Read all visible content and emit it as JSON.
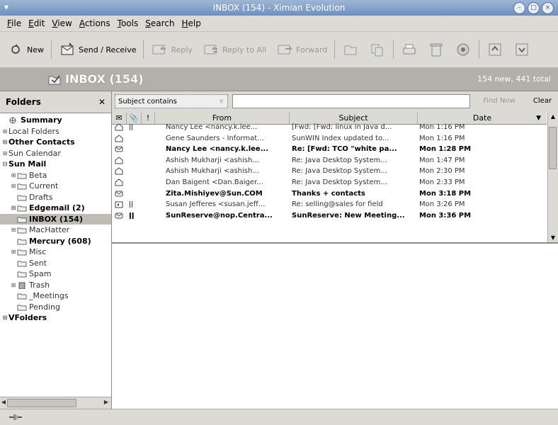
{
  "window": {
    "title": "INBOX (154) - Ximian Evolution"
  },
  "menu": [
    {
      "key": "file",
      "accel": "F",
      "rest": "ile"
    },
    {
      "key": "edit",
      "accel": "E",
      "rest": "dit"
    },
    {
      "key": "view",
      "accel": "V",
      "rest": "iew"
    },
    {
      "key": "actions",
      "accel": "A",
      "rest": "ctions"
    },
    {
      "key": "tools",
      "accel": "T",
      "rest": "ools"
    },
    {
      "key": "search",
      "accel": "S",
      "rest": "earch"
    },
    {
      "key": "help",
      "accel": "H",
      "rest": "elp"
    }
  ],
  "toolbar": {
    "new_label": "New",
    "send_receive_label": "Send / Receive",
    "reply_label": "Reply",
    "reply_all_label": "Reply to All",
    "forward_label": "Forward"
  },
  "folder_header": {
    "name": "INBOX (154)",
    "counts": "154 new, 441 total"
  },
  "sidebar": {
    "header": "Folders",
    "close": "✕",
    "folders": [
      {
        "label": "Summary",
        "bold": true,
        "indent": 0,
        "exp": "",
        "icon": "summary"
      },
      {
        "label": "Local Folders",
        "bold": false,
        "indent": 0,
        "exp": "+",
        "icon": ""
      },
      {
        "label": "Other Contacts",
        "bold": true,
        "indent": 0,
        "exp": "+",
        "icon": ""
      },
      {
        "label": "Sun Calendar",
        "bold": false,
        "indent": 0,
        "exp": "+",
        "icon": ""
      },
      {
        "label": "Sun Mail",
        "bold": true,
        "indent": 0,
        "exp": "-",
        "icon": ""
      },
      {
        "label": "Beta",
        "bold": false,
        "indent": 1,
        "exp": "+",
        "icon": "folder"
      },
      {
        "label": "Current",
        "bold": false,
        "indent": 1,
        "exp": "+",
        "icon": "folder"
      },
      {
        "label": "Drafts",
        "bold": false,
        "indent": 1,
        "exp": "",
        "icon": "folder"
      },
      {
        "label": "Edgemail (2)",
        "bold": true,
        "indent": 1,
        "exp": "+",
        "icon": "folder"
      },
      {
        "label": "INBOX (154)",
        "bold": true,
        "indent": 1,
        "exp": "",
        "icon": "folder",
        "selected": true
      },
      {
        "label": "MacHatter",
        "bold": false,
        "indent": 1,
        "exp": "+",
        "icon": "folder"
      },
      {
        "label": "Mercury (608)",
        "bold": true,
        "indent": 1,
        "exp": "",
        "icon": "folder"
      },
      {
        "label": "Misc",
        "bold": false,
        "indent": 1,
        "exp": "+",
        "icon": "folder"
      },
      {
        "label": "Sent",
        "bold": false,
        "indent": 1,
        "exp": "",
        "icon": "folder"
      },
      {
        "label": "Spam",
        "bold": false,
        "indent": 1,
        "exp": "",
        "icon": "folder"
      },
      {
        "label": "Trash",
        "bold": false,
        "indent": 1,
        "exp": "+",
        "icon": "trash"
      },
      {
        "label": "_Meetings",
        "bold": false,
        "indent": 1,
        "exp": "",
        "icon": "folder"
      },
      {
        "label": "Pending",
        "bold": false,
        "indent": 1,
        "exp": "",
        "icon": "folder"
      },
      {
        "label": "VFolders",
        "bold": true,
        "indent": 0,
        "exp": "+",
        "icon": ""
      }
    ]
  },
  "search": {
    "combo": "Subject contains",
    "find_now": "Find Now",
    "clear": "Clear"
  },
  "columns": {
    "status": "✉",
    "attach": "📎",
    "flag": "!",
    "from": "From",
    "subject": "Subject",
    "date": "Date"
  },
  "messages": [
    {
      "status": "open",
      "attach": "attach",
      "from": "Nancy Lee <nancy.k.lee...",
      "subject": "[Fwd: [Fwd: linux in Java d...",
      "date": "Mon 1:16 PM",
      "unread": false,
      "partial": true
    },
    {
      "status": "open",
      "attach": "",
      "from": "Gene Saunders - Informat...",
      "subject": "SunWIN Index updated to...",
      "date": "Mon 1:16 PM",
      "unread": false
    },
    {
      "status": "closed",
      "attach": "",
      "from": "Nancy Lee <nancy.k.lee...",
      "subject": "Re: [Fwd: TCO \"white pa...",
      "date": "Mon 1:28 PM",
      "unread": true
    },
    {
      "status": "open",
      "attach": "",
      "from": "Ashish Mukharji <ashish...",
      "subject": "Re: Java Desktop System...",
      "date": "Mon 1:47 PM",
      "unread": false
    },
    {
      "status": "open",
      "attach": "",
      "from": "Ashish Mukharji <ashish...",
      "subject": "Re: Java Desktop System...",
      "date": "Mon 2:30 PM",
      "unread": false
    },
    {
      "status": "open",
      "attach": "",
      "from": "Dan Baigent <Dan.Baiger...",
      "subject": "Re: Java Desktop System...",
      "date": "Mon 2:33 PM",
      "unread": false
    },
    {
      "status": "closed",
      "attach": "",
      "from": "Zita.Mishiyev@Sun.COM",
      "subject": "Thanks + contacts",
      "date": "Mon 3:18 PM",
      "unread": true
    },
    {
      "status": "replied",
      "attach": "attach",
      "from": "Susan Jefferes <susan.jeff...",
      "subject": "Re: selling@sales for field",
      "date": "Mon 3:26 PM",
      "unread": false
    },
    {
      "status": "closed",
      "attach": "attach",
      "from": "SunReserve@nop.Centra...",
      "subject": "SunReserve: New Meeting...",
      "date": "Mon 3:36 PM",
      "unread": true
    }
  ],
  "colors": {
    "titlebar": "#7f9dc6",
    "infobar": "#b3b0a9",
    "window_bg": "#dcdad5"
  }
}
